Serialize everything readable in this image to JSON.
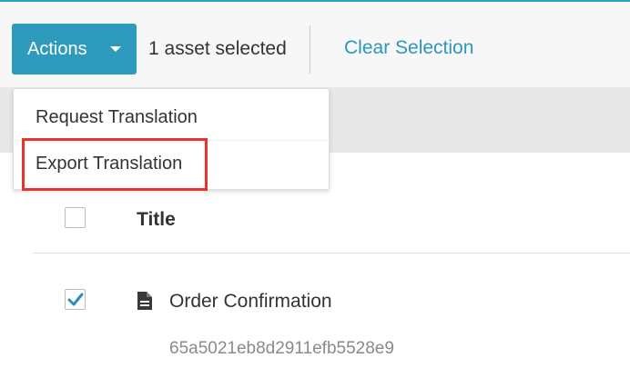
{
  "toolbar": {
    "actions_label": "Actions",
    "selected_count_text": "1 asset selected",
    "clear_selection_label": "Clear Selection"
  },
  "actions_menu": {
    "items": [
      {
        "label": "Request Translation"
      },
      {
        "label": "Export Translation",
        "highlighted": true
      }
    ]
  },
  "table": {
    "header_title": "Title",
    "rows": [
      {
        "checked": true,
        "icon": "document-icon",
        "title": "Order Confirmation",
        "id": "65a5021eb8d2911efb5528e9"
      }
    ]
  },
  "colors": {
    "accent": "#2e9bbd",
    "link": "#2a98ba",
    "highlight": "#e8342a",
    "checkmark": "#2e8fb8"
  }
}
